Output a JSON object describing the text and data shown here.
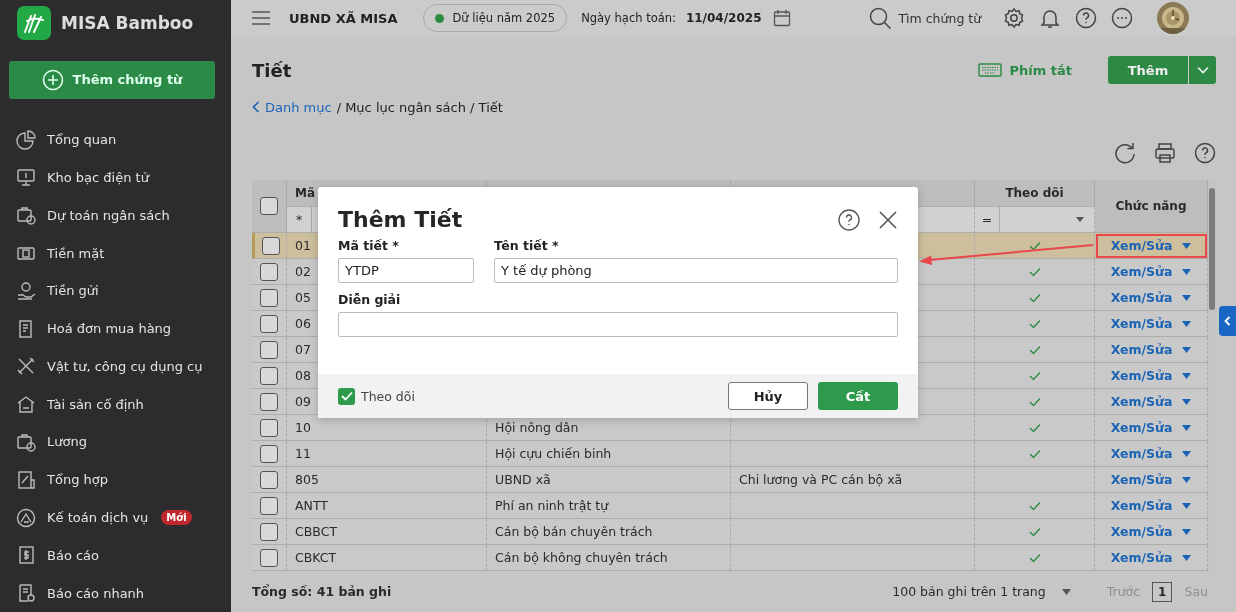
{
  "app": {
    "name": "MISA Bamboo"
  },
  "sidebar": {
    "add_button": "Thêm chứng từ",
    "items": [
      {
        "label": "Tổng quan"
      },
      {
        "label": "Kho bạc điện tử"
      },
      {
        "label": "Dự toán ngân sách"
      },
      {
        "label": "Tiền mặt"
      },
      {
        "label": "Tiền gửi"
      },
      {
        "label": "Hoá đơn mua hàng"
      },
      {
        "label": "Vật tư, công cụ dụng cụ"
      },
      {
        "label": "Tài sản cố định"
      },
      {
        "label": "Lương"
      },
      {
        "label": "Tổng hợp"
      },
      {
        "label": "Kế toán dịch vụ",
        "badge": "Mới"
      },
      {
        "label": "Báo cáo"
      },
      {
        "label": "Báo cáo nhanh"
      }
    ]
  },
  "header": {
    "unit": "UBND XÃ MISA",
    "data_year": "Dữ liệu năm 2025",
    "posting_date_label": "Ngày hạch toán:",
    "posting_date": "11/04/2025",
    "search": "Tìm chứng từ"
  },
  "page": {
    "title": "Tiết",
    "breadcrumb": [
      {
        "label": "Danh mục",
        "link": true
      },
      {
        "label": "/ Mục lục ngân sách / Tiết",
        "link": false
      }
    ],
    "shortcut": "Phím tắt",
    "add_button": "Thêm"
  },
  "table": {
    "all_checked": false,
    "columns": [
      {
        "kind": "code",
        "label": "Mã",
        "filter": "*"
      },
      {
        "kind": "name"
      },
      {
        "kind": "description"
      },
      {
        "kind": "tracked",
        "label": "Theo dõi",
        "filter": "="
      },
      {
        "kind": "actions",
        "label": "Chức năng"
      }
    ],
    "rows": [
      {
        "code": "01",
        "checked": false,
        "selected": true,
        "highlighted": true,
        "tracked": true,
        "action": "Xem/Sửa"
      },
      {
        "code": "02",
        "checked": false,
        "selected": false,
        "highlighted": false,
        "tracked": true,
        "action": "Xem/Sửa"
      },
      {
        "code": "05",
        "checked": false,
        "selected": false,
        "highlighted": false,
        "tracked": true,
        "action": "Xem/Sửa"
      },
      {
        "code": "06",
        "checked": false,
        "selected": false,
        "highlighted": false,
        "tracked": true,
        "action": "Xem/Sửa"
      },
      {
        "code": "07",
        "checked": false,
        "selected": false,
        "highlighted": false,
        "tracked": true,
        "action": "Xem/Sửa"
      },
      {
        "code": "08",
        "checked": false,
        "selected": false,
        "highlighted": false,
        "tracked": true,
        "action": "Xem/Sửa"
      },
      {
        "code": "09",
        "checked": false,
        "selected": false,
        "highlighted": false,
        "tracked": true,
        "action": "Xem/Sửa"
      },
      {
        "code": "10",
        "name": "Hội nông dân",
        "checked": false,
        "selected": false,
        "highlighted": false,
        "tracked": true,
        "action": "Xem/Sửa"
      },
      {
        "code": "11",
        "name": "Hội cựu chiến binh",
        "checked": false,
        "selected": false,
        "highlighted": false,
        "tracked": true,
        "action": "Xem/Sửa"
      },
      {
        "code": "805",
        "name": "UBND xã",
        "description": "Chi lương và PC cán bộ xã",
        "checked": false,
        "selected": false,
        "highlighted": false,
        "tracked": false,
        "action": "Xem/Sửa"
      },
      {
        "code": "ANTT",
        "name": "Phí an ninh trật tự",
        "checked": false,
        "selected": false,
        "highlighted": false,
        "tracked": true,
        "action": "Xem/Sửa"
      },
      {
        "code": "CBBCT",
        "name": "Cán bộ bán chuyên trách",
        "checked": false,
        "selected": false,
        "highlighted": false,
        "tracked": true,
        "action": "Xem/Sửa"
      },
      {
        "code": "CBKCT",
        "name": "Cán bộ không chuyên trách",
        "checked": false,
        "selected": false,
        "highlighted": false,
        "tracked": true,
        "action": "Xem/Sửa"
      }
    ]
  },
  "footer": {
    "total": "Tổng số: 41 bản ghi",
    "page_size": "100 bản ghi trên 1 trang",
    "prev": {
      "label": "Trước",
      "disabled": true
    },
    "page": "1",
    "next": {
      "label": "Sau",
      "disabled": true
    }
  },
  "dialog": {
    "title": "Thêm Tiết",
    "fields": [
      {
        "label": "Mã tiết *",
        "value": "YTDP"
      },
      {
        "label": "Tên tiết *",
        "value": "Y tế dự phòng"
      },
      {
        "label": "Diễn giải"
      }
    ],
    "tracked": {
      "label": "Theo dõi",
      "checked": true
    },
    "buttons": [
      {
        "label": "Hủy",
        "kind": "secondary"
      },
      {
        "label": "Cất",
        "kind": "primary"
      }
    ]
  }
}
